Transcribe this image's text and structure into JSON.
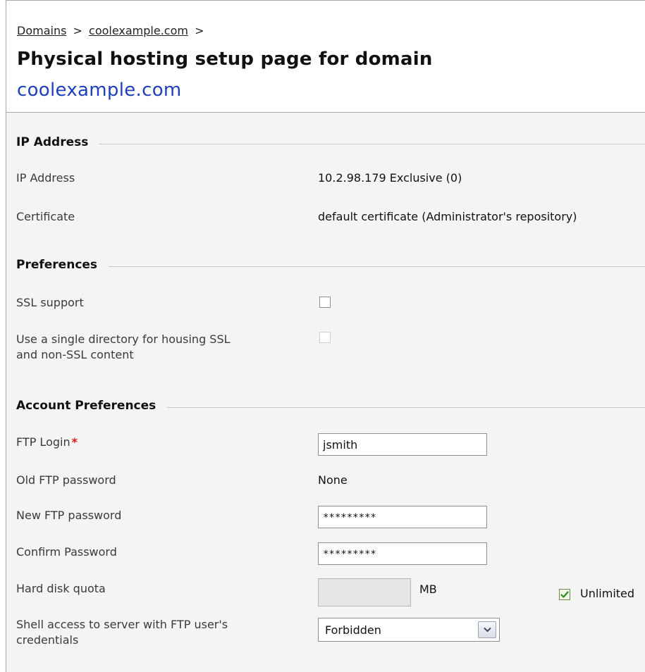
{
  "breadcrumb": {
    "items": [
      "Domains",
      "coolexample.com"
    ],
    "separator": ">"
  },
  "page": {
    "title": "Physical hosting setup page for domain",
    "domain": "coolexample.com"
  },
  "sections": {
    "ip": {
      "title": "IP Address",
      "ip_label": "IP Address",
      "ip_value": "10.2.98.179 Exclusive (0)",
      "cert_label": "Certificate",
      "cert_value": "default certificate (Administrator's repository)"
    },
    "prefs": {
      "title": "Preferences",
      "ssl_label": "SSL support",
      "ssl_checked": false,
      "single_dir_label_line1": "Use a single directory for housing SSL",
      "single_dir_label_line2": "and non-SSL content",
      "single_dir_enabled": false
    },
    "account": {
      "title": "Account Preferences",
      "ftp_login_label": "FTP Login",
      "required_mark": "*",
      "ftp_login_value": "jsmith",
      "old_pwd_label": "Old FTP password",
      "old_pwd_value": "None",
      "new_pwd_label": "New FTP password",
      "new_pwd_value": "*********",
      "confirm_pwd_label": "Confirm Password",
      "confirm_pwd_value": "*********",
      "quota_label": "Hard disk quota",
      "quota_unit": "MB",
      "unlimited_label": "Unlimited",
      "unlimited_checked": true,
      "shell_label_line1": "Shell access to server with FTP user's",
      "shell_label_line2": "credentials",
      "shell_value": "Forbidden"
    }
  },
  "colors": {
    "domain_link": "#1f3fbf",
    "required": "#e0151c",
    "content_bg": "#f4f4f4"
  }
}
